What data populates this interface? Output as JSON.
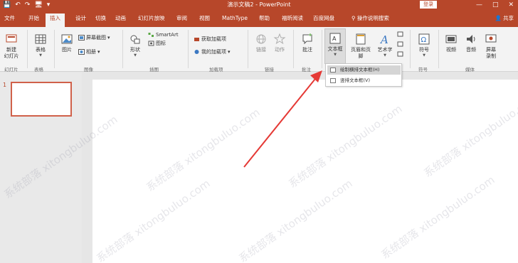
{
  "titlebar": {
    "qat": [
      "💾",
      "↶",
      "↷",
      "🖥",
      "▾"
    ],
    "title": "演示文稿2 - PowerPoint",
    "login": "登录",
    "controls": [
      "—",
      "□",
      "✕"
    ]
  },
  "tabs": [
    "文件",
    "开始",
    "插入",
    "设计",
    "切换",
    "动画",
    "幻灯片放映",
    "审阅",
    "视图",
    "MathType",
    "帮助",
    "福昕阅读",
    "百度网盘",
    "操作说明搜索"
  ],
  "share": "共享",
  "ribbon": {
    "new_slide": "新建\n幻灯片",
    "table": "表格",
    "pictures": "图片",
    "screenshot": "屏幕截图",
    "album": "相册",
    "shapes": "形状",
    "icons": "图标",
    "smartart": "SmartArt",
    "chart": "图表",
    "get_addins": "获取加载项",
    "my_addins": "我的加载项",
    "link": "链接",
    "action": "动作",
    "comment": "批注",
    "textbox": "文本框",
    "header_footer": "页眉和页脚",
    "wordart": "艺术字",
    "symbol": "符号",
    "video": "视频",
    "audio": "音频",
    "screen_record": "屏幕\n录制",
    "group_labels": [
      "幻灯片",
      "表格",
      "图像",
      "插图",
      "加载项",
      "链接",
      "批注",
      "文本",
      "符号",
      "媒体"
    ]
  },
  "dropdown": {
    "items": [
      "绘制横排文本框(H)",
      "竖排文本框(V)"
    ]
  },
  "thumbnails": [
    {
      "number": "1"
    }
  ],
  "watermark": "系统部落 xitongbuluo.com",
  "colors": {
    "accent": "#b7472a",
    "thumb_border": "#d0614a",
    "arrow": "#e53935"
  }
}
